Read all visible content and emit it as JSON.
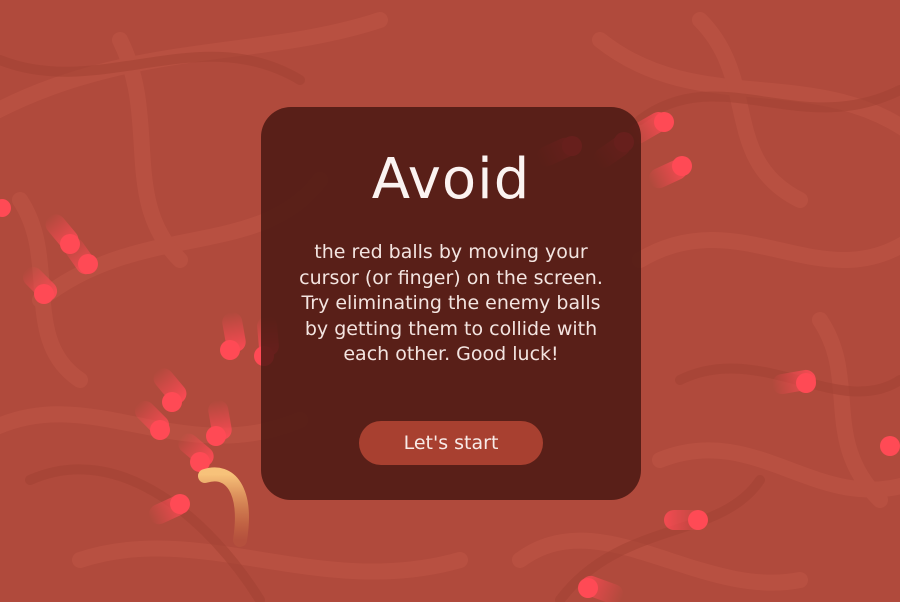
{
  "game": {
    "title": "Avoid",
    "instructions": "the red balls by moving your cursor (or finger) on the screen. Try eliminating the enemy balls by getting them to collide with each other. Good luck!",
    "start_button_label": "Let's start"
  },
  "colors": {
    "background": "#b04a3c",
    "panel": "#46160f",
    "button": "#a84030",
    "enemy_ball": "#ff4a55",
    "player_trail": "#f0a860"
  }
}
